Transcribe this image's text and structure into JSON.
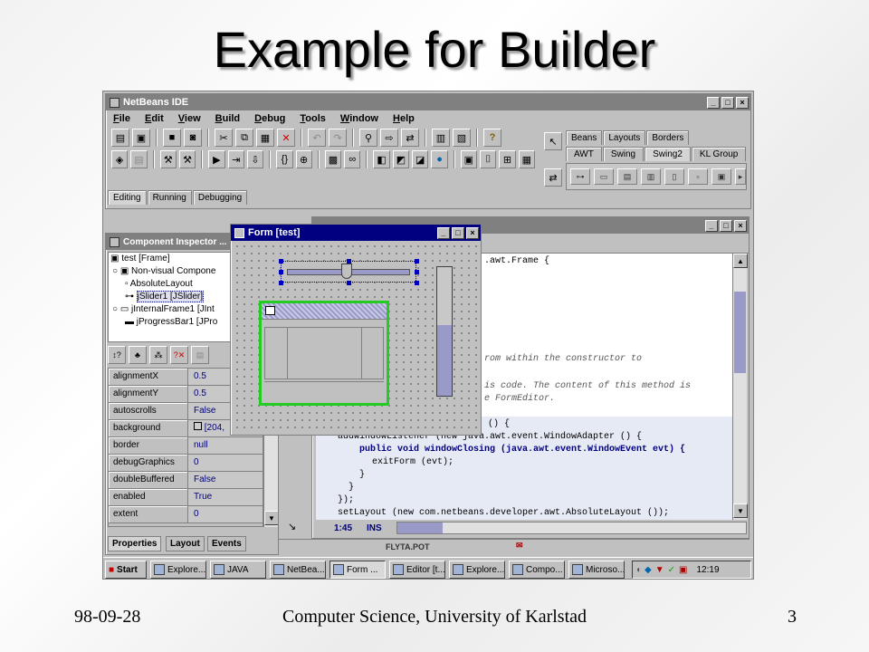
{
  "slide": {
    "title": "Example for Builder",
    "date": "98-09-28",
    "footer": "Computer Science, University of Karlstad",
    "page": "3"
  },
  "ide": {
    "title": "NetBeans IDE",
    "menus": [
      "File",
      "Edit",
      "View",
      "Build",
      "Debug",
      "Tools",
      "Window",
      "Help"
    ],
    "workspace_tabs": [
      "Editing",
      "Running",
      "Debugging"
    ],
    "palette_tabs_row1": [
      "Beans",
      "Layouts",
      "Borders"
    ],
    "palette_tabs_row2": [
      "AWT",
      "Swing",
      "Swing2",
      "KL Group"
    ],
    "selected_palette_tab": "Swing2"
  },
  "inspector": {
    "title": "Component Inspector ...",
    "tree": [
      "test [Frame]",
      "Non-visual Compone",
      "AbsoluteLayout",
      "jSlider1 [JSlider]",
      "jInternalFrame1 [JInt",
      "jProgressBar1 [JPro"
    ],
    "selected_node": "jSlider1 [JSlider]",
    "properties": [
      {
        "name": "alignmentX",
        "value": "0.5"
      },
      {
        "name": "alignmentY",
        "value": "0.5"
      },
      {
        "name": "autoscrolls",
        "value": "False"
      },
      {
        "name": "background",
        "value": "[204,"
      },
      {
        "name": "border",
        "value": "null"
      },
      {
        "name": "debugGraphics",
        "value": "0"
      },
      {
        "name": "doubleBuffered",
        "value": "False"
      },
      {
        "name": "enabled",
        "value": "True"
      },
      {
        "name": "extent",
        "value": "0"
      }
    ],
    "bottom_tabs": [
      "Properties",
      "Layout",
      "Events"
    ]
  },
  "form": {
    "title": "Form [test]",
    "progress_value": 0.55
  },
  "editor": {
    "code_lines": [
      ".awt.Frame {",
      "rom within the constructor to",
      "is code. The content of this method is",
      "e FormEditor.",
      "() {",
      "addWindowListener (new java.awt.event.WindowAdapter () {",
      "public void windowClosing (java.awt.event.WindowEvent evt) {",
      "exitForm (evt);",
      "}",
      "}",
      "});",
      "setLayout (new com.netbeans.developer.awt.AbsoluteLayout ());"
    ],
    "status_position": "1:45",
    "status_mode": "INS",
    "file_label": "FLYTA.POT"
  },
  "taskbar": {
    "start": "Start",
    "items": [
      "Explore...",
      "JAVA",
      "NetBea...",
      "Form ...",
      "Editor [t...",
      "Explore...",
      "Compo...",
      "Microso..."
    ],
    "active_item": "Form ...",
    "clock": "12:19"
  }
}
